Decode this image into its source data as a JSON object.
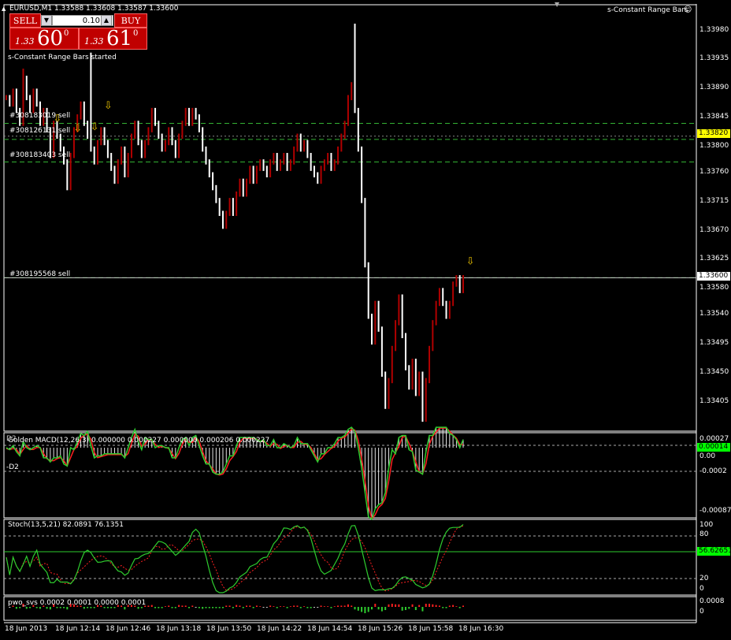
{
  "window": {
    "symbol_line": "EURUSD,M1  1.33588 1.33608 1.33587 1.33600",
    "indicator_title": "s-Constant Range Bars"
  },
  "trade_panel": {
    "sell_label": "SELL",
    "buy_label": "BUY",
    "lot": "0.10",
    "sell_small": "1.33",
    "sell_big": "60",
    "sell_sup": "0",
    "buy_small": "1.33",
    "buy_big": "61",
    "buy_sup": "0"
  },
  "status_text": "s-Constant Range Bars started",
  "orders": [
    {
      "label": "#308183019 sell",
      "price": 1.3384
    },
    {
      "label": "#308126131 sell",
      "price": 1.33815
    },
    {
      "label": "#308183403 sell",
      "price": 1.3378
    },
    {
      "label": "#308195568 sell",
      "price": 1.336
    }
  ],
  "colors": {
    "bull": "#b00000",
    "bear": "#ffffff",
    "order_line": "#34b234",
    "arrow": "#e8c000",
    "macd_hist": "#e6e6e6",
    "macd_signal": "#ff2020",
    "macd_line": "#2ecc2e",
    "stoch_main": "#2ecc2e",
    "stoch_signal": "#ff2020",
    "level": "#2ecc2e",
    "current_price_box": "#ffff00"
  },
  "chart_data": [
    {
      "type": "bar",
      "name": "EURUSD,M1",
      "ylim": [
        1.3337,
        1.33995
      ],
      "yticks": [
        "1.33980",
        "1.33935",
        "1.33890",
        "1.33845",
        "1.33800",
        "1.33760",
        "1.33715",
        "1.33670",
        "1.33625",
        "1.33580",
        "1.33540",
        "1.33495",
        "1.33450",
        "1.33405"
      ],
      "price_tags": [
        {
          "value": "1.33820",
          "price": 1.3382
        },
        {
          "value": "1.33600",
          "price": 1.336
        }
      ],
      "xticks": [
        "18 Jun 2013",
        "18 Jun 12:14",
        "18 Jun 12:46",
        "18 Jun 13:18",
        "18 Jun 13:50",
        "18 Jun 14:22",
        "18 Jun 14:54",
        "18 Jun 15:26",
        "18 Jun 15:58",
        "18 Jun 16:30"
      ],
      "closes": [
        1.3388,
        1.3387,
        1.3389,
        1.3386,
        1.3384,
        1.3391,
        1.3388,
        1.3386,
        1.3389,
        1.3387,
        1.3384,
        1.3386,
        1.3383,
        1.3379,
        1.3384,
        1.3382,
        1.338,
        1.3378,
        1.3374,
        1.3379,
        1.3383,
        1.3385,
        1.3387,
        1.3384,
        1.3382,
        1.338,
        1.3378,
        1.3381,
        1.3383,
        1.3381,
        1.3379,
        1.3377,
        1.3375,
        1.3378,
        1.338,
        1.3376,
        1.3379,
        1.3382,
        1.3384,
        1.3381,
        1.3379,
        1.3381,
        1.3383,
        1.3386,
        1.3384,
        1.3382,
        1.338,
        1.3381,
        1.3383,
        1.3381,
        1.3379,
        1.3382,
        1.3384,
        1.3386,
        1.3384,
        1.3386,
        1.3385,
        1.3383,
        1.338,
        1.3378,
        1.3376,
        1.3374,
        1.3372,
        1.337,
        1.3368,
        1.337,
        1.3372,
        1.337,
        1.3373,
        1.3375,
        1.3373,
        1.3375,
        1.3377,
        1.3375,
        1.3377,
        1.3378,
        1.3377,
        1.3376,
        1.3378,
        1.3379,
        1.3377,
        1.3378,
        1.3379,
        1.3377,
        1.3378,
        1.338,
        1.3382,
        1.338,
        1.3381,
        1.3379,
        1.3377,
        1.3376,
        1.3375,
        1.3377,
        1.3378,
        1.3379,
        1.3377,
        1.3378,
        1.338,
        1.3382,
        1.3384,
        1.3388,
        1.339,
        1.3386,
        1.338,
        1.3372,
        1.3362,
        1.3354,
        1.335,
        1.3356,
        1.3352,
        1.3345,
        1.334,
        1.3344,
        1.3349,
        1.3353,
        1.3357,
        1.3351,
        1.3346,
        1.3343,
        1.3347,
        1.3342,
        1.3345,
        1.3338,
        1.3344,
        1.3349,
        1.3353,
        1.3356,
        1.3358,
        1.3356,
        1.3354,
        1.3356,
        1.3359,
        1.336,
        1.3358,
        1.336
      ],
      "highs_extra": [
        {
          "index": 103,
          "high": 1.33995
        },
        {
          "index": 5,
          "high": 1.33925
        },
        {
          "index": 25,
          "high": 1.3395
        }
      ],
      "arrows": [
        {
          "index": 15,
          "price": 1.33835
        },
        {
          "index": 21,
          "price": 1.3382
        },
        {
          "index": 26,
          "price": 1.33822
        },
        {
          "index": 30,
          "price": 1.33855
        },
        {
          "index": 137,
          "price": 1.33613
        }
      ],
      "ylabel": "",
      "xlabel": ""
    },
    {
      "type": "bar",
      "name": "Golden MACD(12,26,3)",
      "header": "Golden MACD(12,26,3) 0.000000 0.000227 0.000000 0.000206 0.000227",
      "overlay_text": "D2",
      "left_level_label": "-D2",
      "ylim": [
        -0.00089,
        0.00028
      ],
      "yticks": [
        "0.00027",
        "0.00",
        "-0.0002",
        "-0.000879"
      ],
      "current_tag": "0.00014",
      "ylabel": "",
      "xlabel": ""
    },
    {
      "type": "line",
      "name": "Stoch(13,5,21)",
      "header": "Stoch(13,5,21) 82.0891 76.1351",
      "ylim": [
        0,
        100
      ],
      "yticks": [
        "100",
        "80",
        "20",
        "0"
      ],
      "levels": [
        80,
        20
      ],
      "current_tag": "56.62651",
      "ylabel": "",
      "xlabel": ""
    },
    {
      "type": "bar",
      "name": "pwo_svs",
      "header": "pwo_svs 0.0002 0.0001 0.0000 0.0001",
      "yticks": [
        "0.0008",
        "0"
      ],
      "ylabel": "",
      "xlabel": ""
    }
  ]
}
